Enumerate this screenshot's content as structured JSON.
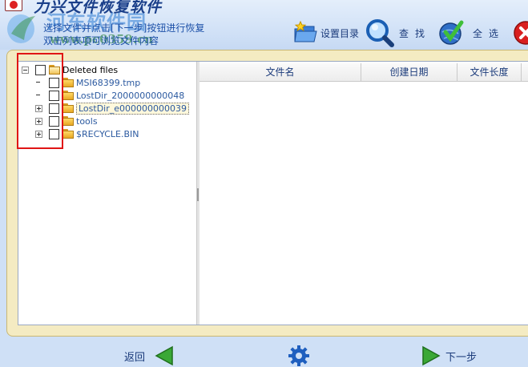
{
  "window": {
    "title": "力兴文件恢复软件"
  },
  "watermark": {
    "text": "河东软件园",
    "url": "www.pc0359.cn"
  },
  "instructions": {
    "line1": "选择文件并点击[下一步]按钮进行恢复",
    "line2": "双击列表项可浏览文件内容"
  },
  "toolbar": {
    "set_dir_label": "设置目录",
    "find_label": "查找",
    "select_all_label": "全选"
  },
  "tree": {
    "root_label": "Deleted files",
    "items": [
      {
        "label": "MSI68399.tmp",
        "expandable": false,
        "selected": false
      },
      {
        "label": "LostDir_2000000000048",
        "expandable": false,
        "selected": false
      },
      {
        "label": "LostDir_e000000000039",
        "expandable": true,
        "selected": true
      },
      {
        "label": "tools",
        "expandable": true,
        "selected": false
      },
      {
        "label": "$RECYCLE.BIN",
        "expandable": true,
        "selected": false
      }
    ]
  },
  "list": {
    "columns": [
      "文件名",
      "创建日期",
      "文件长度"
    ]
  },
  "footer": {
    "back_label": "返回",
    "next_label": "下一步"
  },
  "colors": {
    "accent": "#1c50a8",
    "highlight_box": "#e01515",
    "nav_arrow": "#3aa836"
  }
}
